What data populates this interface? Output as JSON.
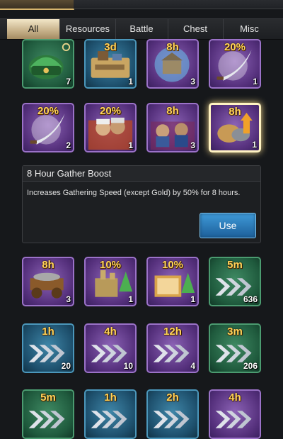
{
  "tabs": [
    "All",
    "Resources",
    "Battle",
    "Chest",
    "Misc"
  ],
  "active_tab": "All",
  "rows": [
    [
      {
        "name": "green-chest-item",
        "frame": "green",
        "tag": "",
        "count": "7",
        "icon": "chest-icon"
      },
      {
        "name": "troop-march-item",
        "frame": "blue",
        "tag": "3d",
        "count": "1",
        "icon": "army-map-icon"
      },
      {
        "name": "peace-shield-item",
        "frame": "purple",
        "tag": "8h",
        "count": "3",
        "icon": "city-shield-icon"
      },
      {
        "name": "attack-boost-item",
        "frame": "purple",
        "tag": "20%",
        "count": "1",
        "icon": "scimitar-icon"
      }
    ],
    [
      {
        "name": "attack-boost-20-item",
        "frame": "purple",
        "tag": "20%",
        "count": "2",
        "icon": "scimitar-icon"
      },
      {
        "name": "troop-boost-item",
        "frame": "purple",
        "tag": "20%",
        "count": "1",
        "icon": "warriors-icon"
      },
      {
        "name": "army-boost-item",
        "frame": "purple",
        "tag": "8h",
        "count": "3",
        "icon": "soldiers-icon"
      },
      {
        "name": "gather-boost-item",
        "frame": "purple",
        "tag": "8h",
        "count": "1",
        "icon": "resource-sacks-icon",
        "selected": true
      }
    ],
    [
      {
        "name": "cart-boost-item",
        "frame": "purple",
        "tag": "8h",
        "count": "3",
        "icon": "cart-icon"
      },
      {
        "name": "city-boost-item",
        "frame": "purple",
        "tag": "10%",
        "count": "1",
        "icon": "city-upgrade-icon"
      },
      {
        "name": "research-boost-item",
        "frame": "purple",
        "tag": "10%",
        "count": "1",
        "icon": "book-upgrade-icon"
      },
      {
        "name": "speedup-5m-item",
        "frame": "green",
        "tag": "5m",
        "count": "636",
        "icon": "speedup-arrows-icon"
      }
    ],
    [
      {
        "name": "speedup-1h-item",
        "frame": "blue",
        "tag": "1h",
        "count": "20",
        "icon": "speedup-arrows-icon"
      },
      {
        "name": "speedup-4h-item",
        "frame": "purple",
        "tag": "4h",
        "count": "10",
        "icon": "speedup-arrows-icon"
      },
      {
        "name": "speedup-12h-item",
        "frame": "purple",
        "tag": "12h",
        "count": "4",
        "icon": "speedup-arrows-icon"
      },
      {
        "name": "speedup-3m-item",
        "frame": "green",
        "tag": "3m",
        "count": "206",
        "icon": "speedup-arrows-icon"
      }
    ],
    [
      {
        "name": "speedup-5m-b-item",
        "frame": "green",
        "tag": "5m",
        "count": "",
        "icon": "speedup-arrows-icon"
      },
      {
        "name": "speedup-1h-b-item",
        "frame": "blue",
        "tag": "1h",
        "count": "",
        "icon": "speedup-arrows-icon"
      },
      {
        "name": "speedup-2h-item",
        "frame": "blue",
        "tag": "2h",
        "count": "",
        "icon": "speedup-arrows-icon"
      },
      {
        "name": "speedup-4h-b-item",
        "frame": "purple",
        "tag": "4h",
        "count": "",
        "icon": "speedup-arrows-icon"
      }
    ]
  ],
  "detail": {
    "title": "8 Hour Gather Boost",
    "description": "Increases Gathering Speed (except Gold) by 50% for 8 hours.",
    "use_label": "Use"
  },
  "colors": {
    "tag_gold": "#ffd35a",
    "use_button": "#2f86c8",
    "selected_border": "#fff3c2"
  }
}
